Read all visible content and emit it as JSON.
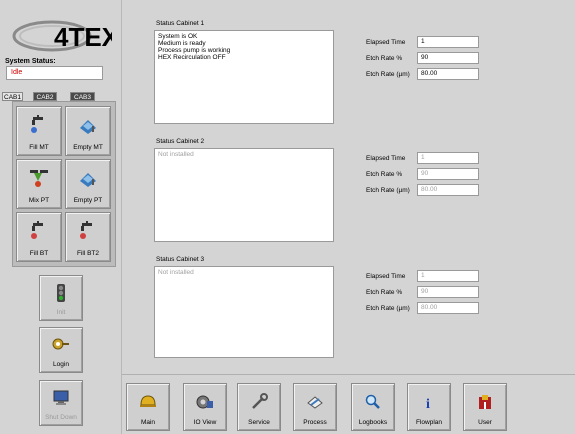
{
  "logo": {
    "text": "4TEX"
  },
  "system_status": {
    "label": "System Status:",
    "value": "Idle"
  },
  "cabinet_tabs": [
    "CAB1",
    "CAB2",
    "CAB3"
  ],
  "panel_buttons": [
    {
      "label": "Fill MT",
      "icon": "faucet-icon"
    },
    {
      "label": "Empty MT",
      "icon": "empty-tank-icon"
    },
    {
      "label": "Mix PT",
      "icon": "mix-icon"
    },
    {
      "label": "Empty PT",
      "icon": "empty-tank-icon"
    },
    {
      "label": "Fill BT",
      "icon": "faucet-icon"
    },
    {
      "label": "Fill BT2",
      "icon": "faucet-icon"
    }
  ],
  "side_buttons": [
    {
      "label": "Init",
      "icon": "traffic-light-icon",
      "enabled": false
    },
    {
      "label": "Login",
      "icon": "key-icon",
      "enabled": true
    },
    {
      "label": "Shut Down",
      "icon": "computer-icon",
      "enabled": false
    }
  ],
  "cabinets": [
    {
      "title": "Status Cabinet 1",
      "messages": "System is OK\nMedium is ready\nProcess pump is working\nHEX Recirculation OFF",
      "installed": true,
      "elapsed_label": "Elapsed Time",
      "elapsed_value": "1",
      "etch_pct_label": "Etch Rate %",
      "etch_pct_value": "90",
      "etch_um_label": "Etch Rate (µm)",
      "etch_um_value": "80.00"
    },
    {
      "title": "Status Cabinet 2",
      "messages": "Not installed",
      "installed": false,
      "elapsed_label": "Elapsed Time",
      "elapsed_value": "1",
      "etch_pct_label": "Etch Rate %",
      "etch_pct_value": "90",
      "etch_um_label": "Etch Rate (µm)",
      "etch_um_value": "80.00"
    },
    {
      "title": "Status Cabinet 3",
      "messages": "Not installed",
      "installed": false,
      "elapsed_label": "Elapsed Time",
      "elapsed_value": "1",
      "etch_pct_label": "Etch Rate %",
      "etch_pct_value": "90",
      "etch_um_label": "Etch Rate (µm)",
      "etch_um_value": "80.00"
    }
  ],
  "nav_buttons": [
    {
      "label": "Main",
      "icon": "helmet-icon"
    },
    {
      "label": "IO View",
      "icon": "gear-monitor-icon"
    },
    {
      "label": "Service",
      "icon": "wrench-icon"
    },
    {
      "label": "Process",
      "icon": "process-icon"
    },
    {
      "label": "Logbooks",
      "icon": "magnifier-icon"
    },
    {
      "label": "Flowplan",
      "icon": "info-icon"
    },
    {
      "label": "User",
      "icon": "user-icon"
    }
  ],
  "colors": {
    "status_value": "#cc0000",
    "background": "#d4d4d4"
  }
}
